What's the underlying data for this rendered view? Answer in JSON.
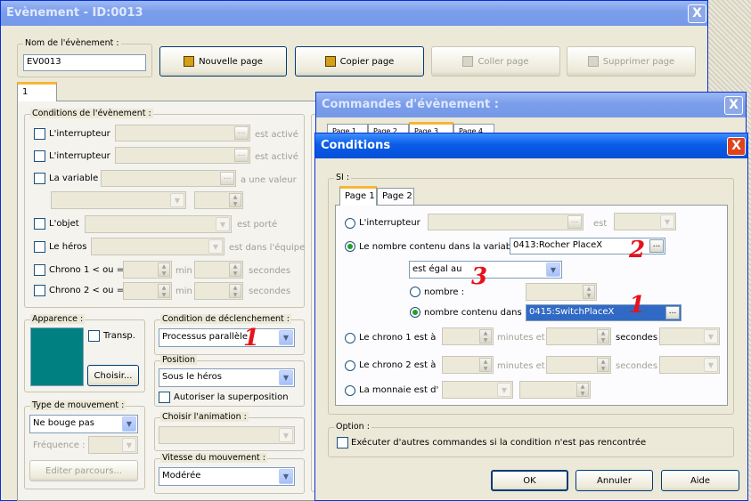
{
  "event_window": {
    "title": "Evènement - ID:0013",
    "close": "X",
    "name_group": "Nom de l'évènement :",
    "name_value": "EV0013",
    "buttons": {
      "new_page": "Nouvelle page",
      "copy_page": "Copier page",
      "paste_page": "Coller page",
      "delete_page": "Supprimer page"
    },
    "page_tab": "1",
    "conditions": {
      "title": "Conditions de l'évènement :",
      "switch1": "L'interrupteur",
      "switch1_suffix": "est activé",
      "switch2": "L'interrupteur",
      "switch2_suffix": "est activé",
      "variable": "La variable",
      "variable_suffix": "a une valeur",
      "object": "L'objet",
      "object_suffix": "est porté",
      "hero": "Le héros",
      "hero_suffix": "est dans l'équipe",
      "timer1": "Chrono 1 < ou = à",
      "timer1_min": "min",
      "timer1_sec": "secondes",
      "timer2": "Chrono 2 < ou = à",
      "timer2_min": "min",
      "timer2_sec": "secondes",
      "dots": "..."
    },
    "appearance": {
      "title": "Apparence :",
      "transparent": "Transp.",
      "choose": "Choisir..."
    },
    "trigger": {
      "title": "Condition de déclenchement :",
      "value": "Processus parallèle"
    },
    "position": {
      "title": "Position",
      "value": "Sous le héros",
      "overlap": "Autoriser la superposition"
    },
    "animation": {
      "title": "Choisir l'animation :"
    },
    "movement_type": {
      "title": "Type de mouvement :",
      "value": "Ne bouge pas",
      "frequency": "Fréquence :",
      "edit_route": "Editer parcours..."
    },
    "movement_speed": {
      "title": "Vitesse du mouvement :",
      "value": "Modérée"
    }
  },
  "commands_window": {
    "title": "Commandes d'évènement :",
    "close": "X",
    "tabs": [
      "Page 1",
      "Page 2",
      "Page 3",
      "Page 4"
    ]
  },
  "conditions_dialog": {
    "title": "Conditions",
    "close": "X",
    "si_group": "SI :",
    "tabs": [
      "Page 1",
      "Page 2"
    ],
    "switch_label": "L'interrupteur",
    "switch_suffix": "est",
    "variable_label": "Le nombre contenu dans la variable",
    "variable_value": "0413:Rocher PlaceX",
    "comparison": "est égal au",
    "number_label": "nombre :",
    "var_number_label": "nombre contenu dans :",
    "var_number_value": "0415:SwitchPlaceX",
    "timer1_label": "Le chrono 1 est à",
    "timer1_min": "minutes et",
    "timer1_sec": "secondes",
    "timer2_label": "Le chrono 2 est à",
    "timer2_min": "minutes et",
    "timer2_sec": "secondes",
    "money_label": "La monnaie est d'",
    "dots": "...",
    "option_group": "Option :",
    "option_checkbox": "Exécuter d'autres commandes si la condition n'est pas rencontrée",
    "ok": "OK",
    "cancel": "Annuler",
    "help": "Aide"
  },
  "annotations": {
    "one_a": "1",
    "two": "2",
    "three": "3",
    "one_b": "1"
  },
  "colors": {
    "title_active": "#0a5ce8",
    "window_bg": "#ece9d8",
    "sprite_preview": "#008080",
    "selection": "#316ac5",
    "annotation": "#e8121a"
  }
}
